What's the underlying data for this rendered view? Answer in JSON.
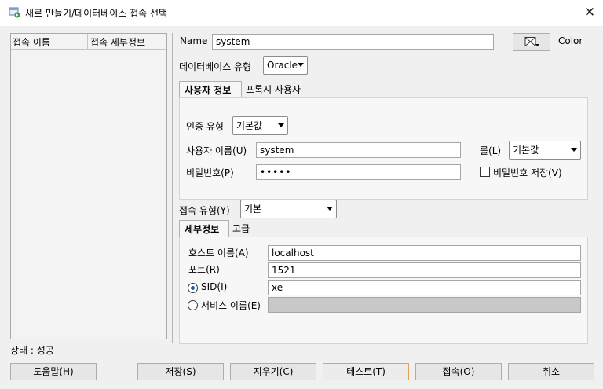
{
  "window": {
    "title": "새로 만들기/데이터베이스 접속 선택",
    "close_symbol": "✕"
  },
  "connection_list": {
    "col_name": "접속 이름",
    "col_details": "접속 세부정보"
  },
  "form": {
    "name_label": "Name",
    "name_value": "system",
    "color_label": "Color",
    "db_type_label": "데이터베이스 유형",
    "db_type_value": "Oracle"
  },
  "user_tabs": {
    "active": "사용자 정보",
    "other": "프록시 사용자"
  },
  "auth": {
    "auth_type_label": "인증 유형",
    "auth_type_value": "기본값",
    "username_label": "사용자 이름(U)",
    "username_value": "system",
    "role_label": "롤(L)",
    "role_value": "기본값",
    "password_label": "비밀번호(P)",
    "password_value": "•••••",
    "save_password_label": "비밀번호 저장(V)"
  },
  "connection": {
    "type_label": "접속 유형(Y)",
    "type_value": "기본"
  },
  "detail_tabs": {
    "active": "세부정보",
    "other": "고급"
  },
  "details": {
    "host_label": "호스트 이름(A)",
    "host_value": "localhost",
    "port_label": "포트(R)",
    "port_value": "1521",
    "sid_label": "SID(I)",
    "sid_value": "xe",
    "service_label": "서비스 이름(E)",
    "service_value": ""
  },
  "status": "상태 : 성공",
  "buttons": {
    "help": "도움말(H)",
    "save": "저장(S)",
    "clear": "지우기(C)",
    "test": "테스트(T)",
    "connect": "접속(O)",
    "cancel": "취소"
  }
}
